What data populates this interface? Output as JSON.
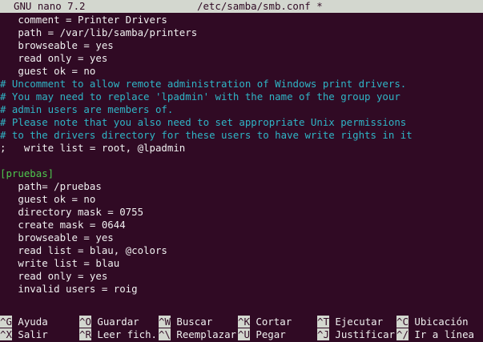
{
  "titlebar": {
    "app": "GNU nano 7.2",
    "file": "/etc/samba/smb.conf *"
  },
  "editor": {
    "lines": [
      {
        "text": "   comment = Printer Drivers",
        "kind": "text"
      },
      {
        "text": "   path = /var/lib/samba/printers",
        "kind": "text"
      },
      {
        "text": "   browseable = yes",
        "kind": "text"
      },
      {
        "text": "   read only = yes",
        "kind": "text"
      },
      {
        "text": "   guest ok = no",
        "kind": "text"
      },
      {
        "text": "# Uncomment to allow remote administration of Windows print drivers.",
        "kind": "comment"
      },
      {
        "text": "# You may need to replace 'lpadmin' with the name of the group your",
        "kind": "comment"
      },
      {
        "text": "# admin users are members of.",
        "kind": "comment"
      },
      {
        "text": "# Please note that you also need to set appropriate Unix permissions",
        "kind": "comment"
      },
      {
        "text": "# to the drivers directory for these users to have write rights in it",
        "kind": "comment"
      },
      {
        "text": ";   write list = root, @lpadmin",
        "kind": "text"
      },
      {
        "text": "",
        "kind": "text"
      },
      {
        "text": "[pruebas]",
        "kind": "section"
      },
      {
        "text": "   path= /pruebas",
        "kind": "text"
      },
      {
        "text": "   guest ok = no",
        "kind": "text"
      },
      {
        "text": "   directory mask = 0755",
        "kind": "text"
      },
      {
        "text": "   create mask = 0644",
        "kind": "text"
      },
      {
        "text": "   browseable = yes",
        "kind": "text"
      },
      {
        "text": "   read list = blau, @colors",
        "kind": "text"
      },
      {
        "text": "   write list = blau",
        "kind": "text"
      },
      {
        "text": "   read only = yes",
        "kind": "text"
      },
      {
        "text": "   invalid users = roig",
        "kind": "text"
      }
    ]
  },
  "shortcuts": {
    "row1": [
      {
        "key": "^G",
        "label": "Ayuda"
      },
      {
        "key": "^O",
        "label": "Guardar"
      },
      {
        "key": "^W",
        "label": "Buscar"
      },
      {
        "key": "^K",
        "label": "Cortar"
      },
      {
        "key": "^T",
        "label": "Ejecutar"
      },
      {
        "key": "^C",
        "label": "Ubicación"
      }
    ],
    "row2": [
      {
        "key": "^X",
        "label": "Salir"
      },
      {
        "key": "^R",
        "label": "Leer fich."
      },
      {
        "key": "^\\",
        "label": "Reemplazar"
      },
      {
        "key": "^U",
        "label": "Pegar"
      },
      {
        "key": "^J",
        "label": "Justificar"
      },
      {
        "key": "^/",
        "label": "Ir a línea"
      }
    ]
  },
  "colors": {
    "background": "#300a24",
    "text": "#f0f0f0",
    "comment": "#2fb5c6",
    "section": "#4ec84e",
    "bar": "#d3d7cf"
  }
}
